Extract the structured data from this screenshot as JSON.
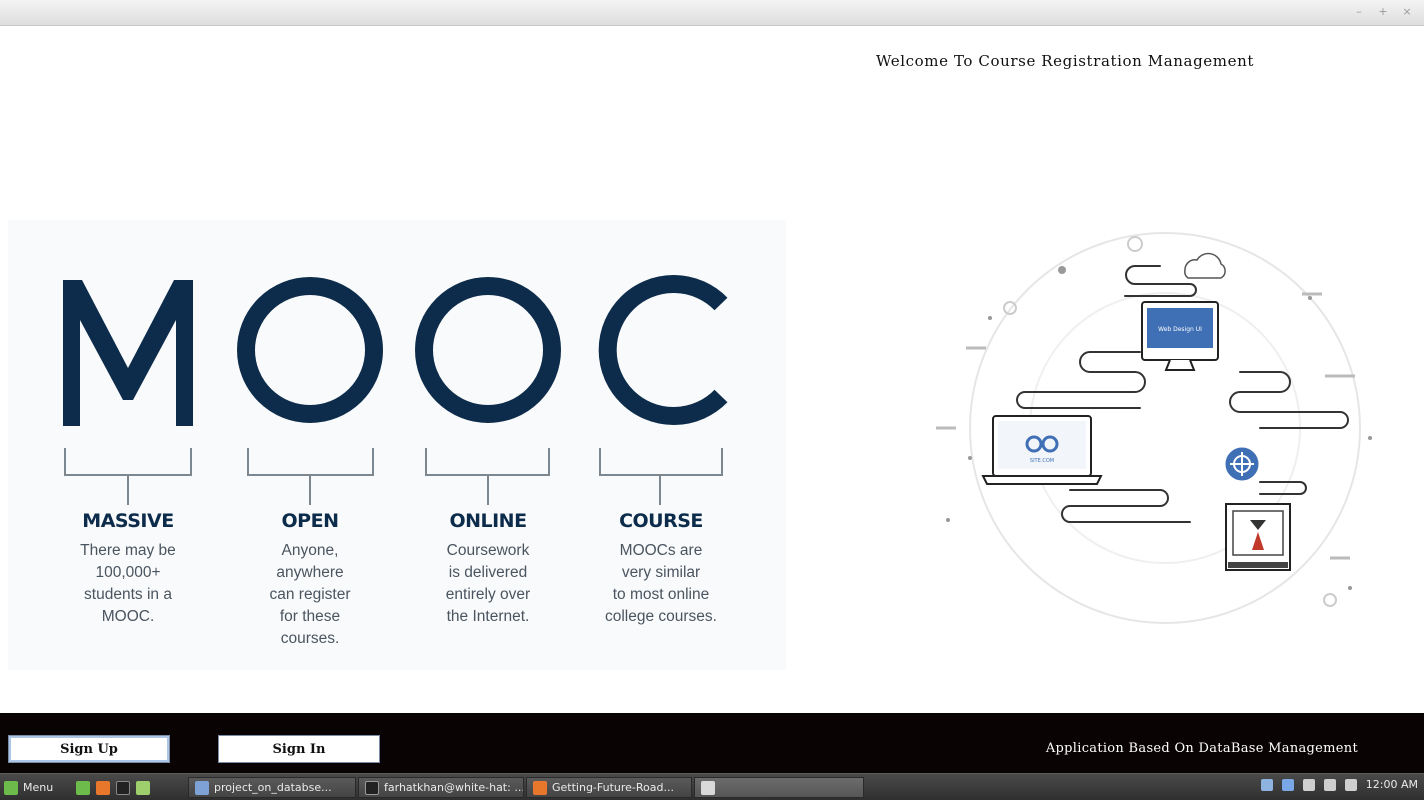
{
  "window": {
    "controls": [
      "–",
      "+",
      "×"
    ]
  },
  "header": {
    "welcome_text": "Welcome To Course Registration Management"
  },
  "mooc": {
    "letters": [
      "M",
      "O",
      "O",
      "C"
    ],
    "columns": [
      {
        "title": "MASSIVE",
        "description": "There may be\n100,000+\nstudents in a\nMOOC."
      },
      {
        "title": "OPEN",
        "description": "Anyone,\nanywhere\ncan register\nfor these\ncourses."
      },
      {
        "title": "ONLINE",
        "description": "Coursework\nis delivered\nentirely over\nthe Internet."
      },
      {
        "title": "COURSE",
        "description": "MOOCs are\nvery similar\nto most online\ncollege courses."
      }
    ],
    "colors": {
      "navy": "#0d2c4b",
      "text": "#4a5560",
      "bracket": "#7d8790"
    }
  },
  "illustration": {
    "monitor_text": "Web Design UI",
    "laptop_text": "SITE.COM"
  },
  "footer": {
    "signup_label": "Sign Up",
    "signin_label": "Sign In",
    "caption": "Application Based On DataBase Management"
  },
  "taskbar": {
    "menu_label": "Menu",
    "tasks": [
      "project_on_databse...",
      "farhatkhan@white-hat: ...",
      "Getting-Future-Road..."
    ],
    "clock": "12:00 AM"
  }
}
